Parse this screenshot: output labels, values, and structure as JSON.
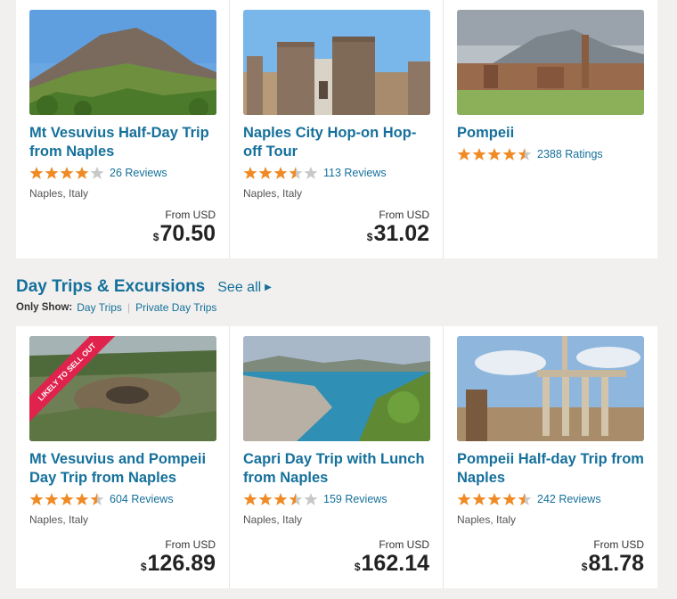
{
  "top_cards": [
    {
      "title": "Mt Vesuvius Half-Day Trip from Naples",
      "rating": 4,
      "reviews": "26 Reviews",
      "location": "Naples, Italy",
      "from": "From USD",
      "currency": "$",
      "price": "70.50",
      "image": "vesuvius-mountain"
    },
    {
      "title": "Naples City Hop-on Hop-off Tour",
      "rating": 3.5,
      "reviews": "113 Reviews",
      "location": "Naples, Italy",
      "from": "From USD",
      "currency": "$",
      "price": "31.02",
      "image": "castle"
    },
    {
      "title": "Pompeii",
      "rating": 4.5,
      "reviews": "2388 Ratings",
      "image": "pompeii-ruins"
    }
  ],
  "section": {
    "title": "Day Trips & Excursions",
    "see_all": "See all"
  },
  "filters": {
    "label": "Only Show:",
    "items": [
      "Day Trips",
      "Private Day Trips"
    ]
  },
  "bottom_cards": [
    {
      "badge": "LIKELY TO SELL OUT",
      "title": "Mt Vesuvius and Pompeii Day Trip from Naples",
      "rating": 4.5,
      "reviews": "604 Reviews",
      "location": "Naples, Italy",
      "from": "From USD",
      "currency": "$",
      "price": "126.89",
      "image": "vesuvius-crater"
    },
    {
      "title": "Capri Day Trip with Lunch from Naples",
      "rating": 3.5,
      "reviews": "159 Reviews",
      "location": "Naples, Italy",
      "from": "From USD",
      "currency": "$",
      "price": "162.14",
      "image": "coast"
    },
    {
      "title": "Pompeii Half-day Trip from Naples",
      "rating": 4.5,
      "reviews": "242 Reviews",
      "location": "Naples, Italy",
      "from": "From USD",
      "currency": "$",
      "price": "81.78",
      "image": "columns"
    }
  ],
  "colors": {
    "link": "#15709b",
    "star": "#f08a24",
    "star_empty": "#c8c8c8",
    "badge": "#e0234d"
  }
}
